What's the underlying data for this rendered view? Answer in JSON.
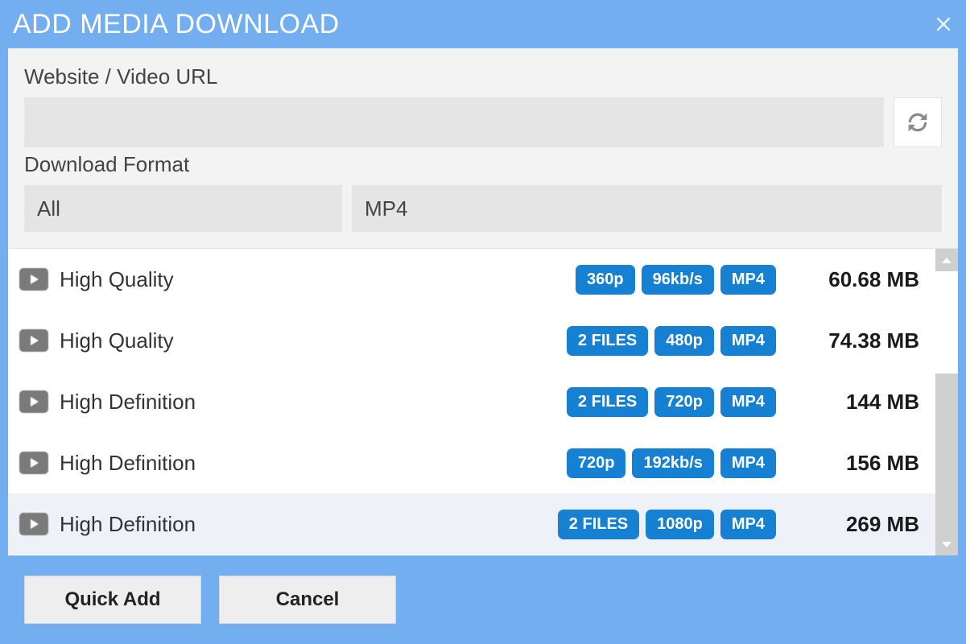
{
  "title": "ADD MEDIA DOWNLOAD",
  "url_section": {
    "label": "Website / Video URL",
    "value": ""
  },
  "format_section": {
    "label": "Download Format",
    "type_value": "All",
    "container_value": "MP4"
  },
  "rows": [
    {
      "name": "High Quality",
      "tags": [
        "360p",
        "96kb/s",
        "MP4"
      ],
      "size": "60.68 MB",
      "selected": false
    },
    {
      "name": "High Quality",
      "tags": [
        "2 FILES",
        "480p",
        "MP4"
      ],
      "size": "74.38 MB",
      "selected": false
    },
    {
      "name": "High Definition",
      "tags": [
        "2 FILES",
        "720p",
        "MP4"
      ],
      "size": "144 MB",
      "selected": false
    },
    {
      "name": "High Definition",
      "tags": [
        "720p",
        "192kb/s",
        "MP4"
      ],
      "size": "156 MB",
      "selected": false
    },
    {
      "name": "High Definition",
      "tags": [
        "2 FILES",
        "1080p",
        "MP4"
      ],
      "size": "269 MB",
      "selected": true
    }
  ],
  "footer": {
    "quick_add": "Quick Add",
    "cancel": "Cancel"
  }
}
